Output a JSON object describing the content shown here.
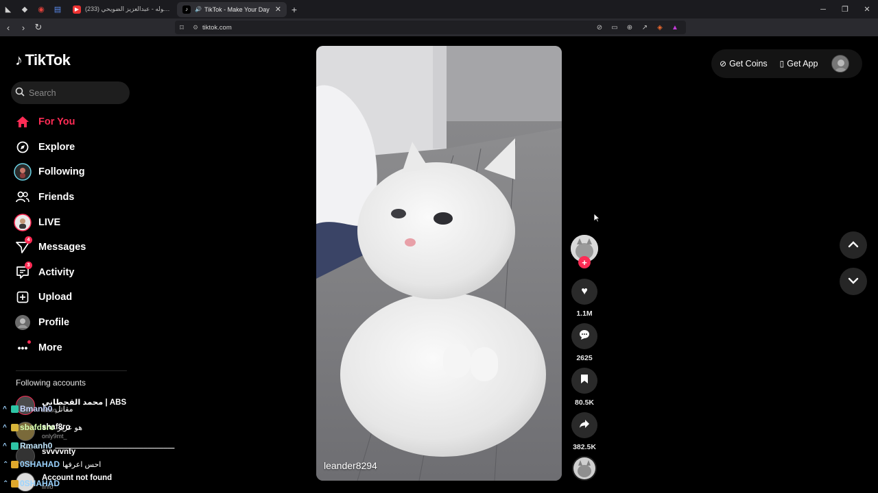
{
  "browser": {
    "tabs": [
      {
        "title": "",
        "active": false
      },
      {
        "title": "",
        "active": false
      },
      {
        "title": "",
        "active": false
      },
      {
        "title": "",
        "active": false
      },
      {
        "title": "(233) دنيا الوله - عبدالعزيز الضويحي /",
        "active": false
      },
      {
        "title": "TikTok - Make Your Day",
        "active": true
      }
    ],
    "url": "tiktok.com"
  },
  "brand": {
    "name": "TikTok"
  },
  "search": {
    "placeholder": "Search"
  },
  "nav": [
    {
      "label": "For You",
      "icon": "home-icon",
      "active": true
    },
    {
      "label": "Explore",
      "icon": "compass-icon"
    },
    {
      "label": "Following",
      "icon": "following-avatar-icon"
    },
    {
      "label": "Friends",
      "icon": "friends-icon"
    },
    {
      "label": "LIVE",
      "icon": "live-icon"
    },
    {
      "label": "Messages",
      "icon": "messages-icon",
      "badge": "4"
    },
    {
      "label": "Activity",
      "icon": "activity-icon",
      "badge": "3"
    },
    {
      "label": "Upload",
      "icon": "upload-icon"
    },
    {
      "label": "Profile",
      "icon": "profile-avatar-icon"
    },
    {
      "label": "More",
      "icon": "more-icon",
      "dot": true
    }
  ],
  "following_accounts": {
    "heading": "Following accounts",
    "items": [
      {
        "name": "محمد القحطاني | ABS",
        "handle": "iabsq",
        "live": "LIVE"
      },
      {
        "name": "shaf8ro",
        "handle": "only9mt_"
      },
      {
        "name": "svvvvnty",
        "handle": ""
      },
      {
        "name": "Account not found",
        "handle": "iinfo"
      }
    ]
  },
  "chat": [
    {
      "user": "Bmanh0",
      "msg": "مقاتل"
    },
    {
      "user": "sbafdsro",
      "msg": "هو عزيز"
    },
    {
      "user": "Rmanh0",
      "msg": "ــــــــــــــــــــــــــــــــــــــــــــــــــــــ"
    },
    {
      "user": "0SHAHAD",
      "msg": "احس اعرفها"
    },
    {
      "user": "0SHAHAD",
      "msg": ""
    }
  ],
  "video": {
    "author": "leander8294"
  },
  "actions": {
    "likes": "1.1M",
    "comments": "2625",
    "saves": "80.5K",
    "shares": "382.5K"
  },
  "topbar": {
    "coins_label": "Get Coins",
    "app_label": "Get App"
  },
  "colors": {
    "accent": "#fe2c55"
  }
}
